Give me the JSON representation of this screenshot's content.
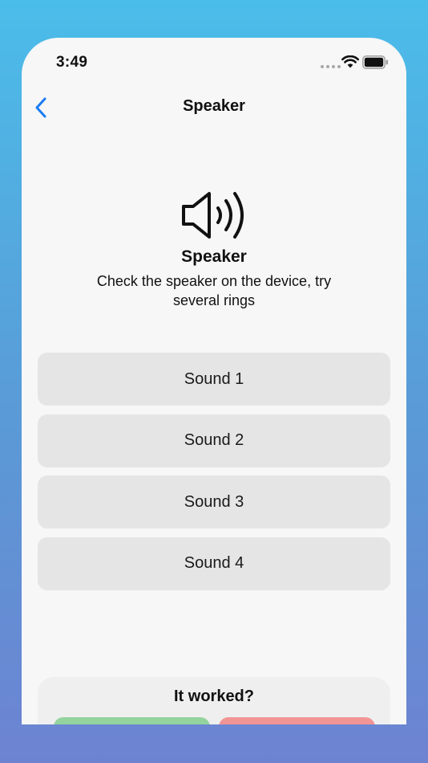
{
  "status_bar": {
    "time": "3:49"
  },
  "nav": {
    "title": "Speaker",
    "back_icon": "chevron-left-icon",
    "accent_color": "#1a7cf2"
  },
  "test": {
    "icon": "speaker-wave-icon",
    "title": "Speaker",
    "description": "Check the speaker on the device, try several rings"
  },
  "sounds": [
    {
      "label": "Sound 1"
    },
    {
      "label": "Sound 2"
    },
    {
      "label": "Sound 3"
    },
    {
      "label": "Sound 4"
    }
  ],
  "feedback": {
    "question": "It worked?",
    "yes_color": "#93d39e",
    "no_color": "#f29595"
  }
}
